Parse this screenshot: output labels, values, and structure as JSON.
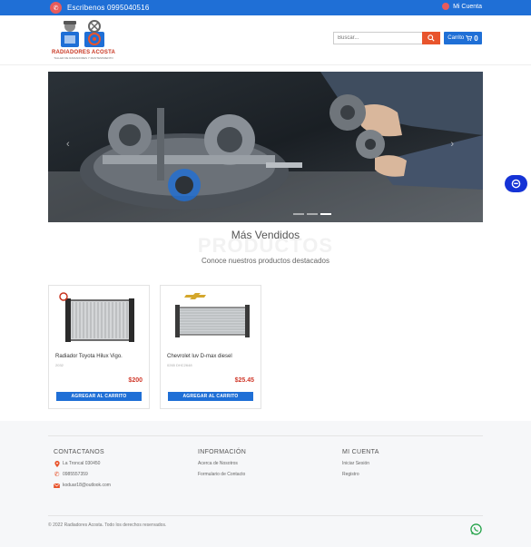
{
  "topbar": {
    "phone_text": "Escribenos 0995040516",
    "account_label": "Mi Cuenta",
    "bg_color": "#1f6fd6",
    "icon_color": "#e85b5b"
  },
  "header": {
    "logo_name": "RADIADORES ACOSTA",
    "logo_tagline": "TALLER DE RADIADORES Y MANTENIMIENTO",
    "search_placeholder": "Buscar...",
    "cart_label": "Carrito",
    "cart_count": "0",
    "accent_color": "#e8542c"
  },
  "hero": {
    "slide_count": 3,
    "active_slide": 3
  },
  "section": {
    "title": "Más Vendidos",
    "bg_title": "PRODUCTOS",
    "subtitle": "Conoce nuestros productos destacados"
  },
  "products": [
    {
      "name": "Radiador Toyota Hilux Vigo.",
      "sku": "2032",
      "price": "$200",
      "button": "AGREGAR AL CARRITO",
      "brand_icon": "toyota-logo-icon"
    },
    {
      "name": "Chevrolet luv D-max diesel",
      "sku": "0265 DHC2648",
      "price": "$25.45",
      "button": "AGREGAR AL CARRITO",
      "brand_icon": "chevrolet-logo-icon"
    }
  ],
  "footer": {
    "contact": {
      "heading": "CONTACTANOS",
      "address": "La Troncal 030450",
      "phone": "0985557359",
      "email": "koduar18@outlook.com"
    },
    "info": {
      "heading": "INFORMACIÓN",
      "links": [
        "Acerca de Nosotros",
        "Formulario de Contacto"
      ]
    },
    "account": {
      "heading": "MI CUENTA",
      "links": [
        "Iniciar Sesión",
        "Registro"
      ]
    },
    "copyright": "© 2022 Radiadores Acosta. Todo los derechos reservados."
  }
}
